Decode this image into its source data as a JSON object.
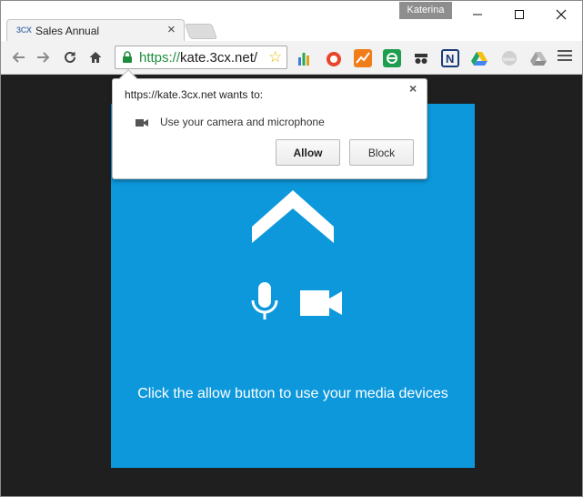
{
  "window": {
    "profile_name": "Katerina"
  },
  "tab": {
    "favicon_text": "3CX",
    "title": "Sales Annual",
    "close_glyph": "×"
  },
  "toolbar": {
    "url_scheme": "https://",
    "url_host": "kate.3cx.net/",
    "extensions": [
      {
        "name": "bar-chart-extension-icon",
        "color": "#3b7dd8"
      },
      {
        "name": "pomodoro-extension-icon",
        "color": "#e8462a"
      },
      {
        "name": "trend-extension-icon",
        "color": "#f07d1a"
      },
      {
        "name": "sync-extension-icon",
        "color": "#1f9d4f"
      },
      {
        "name": "incognito-extension-icon",
        "color": "#333333"
      },
      {
        "name": "n-extension-icon",
        "color": "#1a3b7a"
      },
      {
        "name": "google-drive-icon",
        "color": "#2f9e44"
      },
      {
        "name": "www-extension-icon",
        "color": "#b0b0b0"
      },
      {
        "name": "gray-drive-icon",
        "color": "#a8a8a8"
      }
    ]
  },
  "permission_bubble": {
    "heading": "https://kate.3cx.net wants to:",
    "permission_text": "Use your camera and microphone",
    "allow_label": "Allow",
    "block_label": "Block",
    "close_glyph": "×"
  },
  "panel": {
    "instruction": "Click the allow button to use your media devices",
    "background_color": "#0d98dc"
  }
}
